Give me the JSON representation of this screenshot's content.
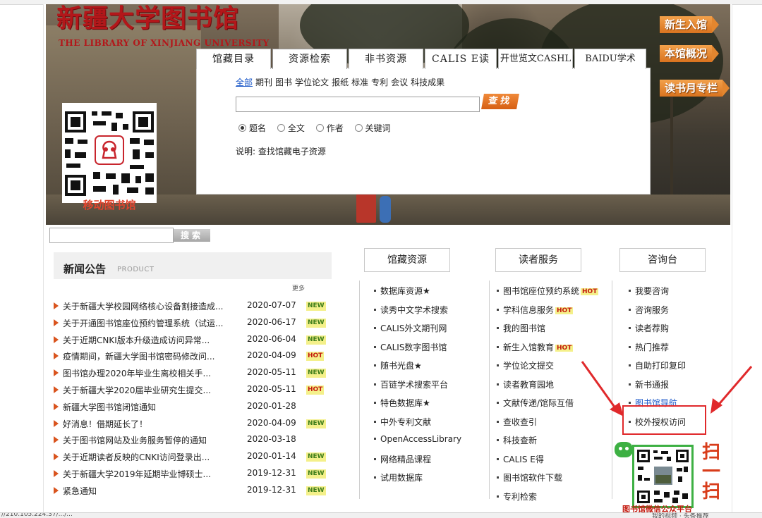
{
  "header": {
    "title": "新疆大学图书馆",
    "subtitle": "THE LIBRARY OF XINJIANG UNIVERSITY",
    "side_buttons": [
      "新生入馆",
      "本馆概况",
      "读书月专栏"
    ],
    "qr_caption": "移动图书馆"
  },
  "search": {
    "tabs": [
      "馆藏目录",
      "资源检索",
      "非书资源",
      "CALIS E读",
      "开世览文CASHL",
      "BAIDU学术"
    ],
    "active_tab": "资源检索",
    "categories": [
      "全部",
      "期刊",
      "图书",
      "学位论文",
      "报纸",
      "标准",
      "专利",
      "会议",
      "科技成果"
    ],
    "selected_category": "全部",
    "find_button": "查找",
    "radios": [
      "题名",
      "全文",
      "作者",
      "关键词"
    ],
    "selected_radio": "题名",
    "note": "说明: 查找馆藏电子资源",
    "site_search_button": "搜索"
  },
  "news": {
    "title": "新闻公告",
    "subtitle": "PRODUCT",
    "more": "更多",
    "items": [
      {
        "title": "关于新疆大学校园网络核心设备割接造成...",
        "date": "2020-07-07",
        "badge": "NEW"
      },
      {
        "title": "关于开通图书馆座位预约管理系统（试运...",
        "date": "2020-06-17",
        "badge": "NEW"
      },
      {
        "title": "关于近期CNKI版本升级造成访问异常...",
        "date": "2020-06-04",
        "badge": "NEW"
      },
      {
        "title": " 疫情期间，新疆大学图书馆密码修改问...",
        "date": "2020-04-09",
        "badge": "HOT"
      },
      {
        "title": "图书馆办理2020年毕业生离校相关手...",
        "date": "2020-05-11",
        "badge": "NEW"
      },
      {
        "title": "关于新疆大学2020届毕业研究生提交...",
        "date": "2020-05-11",
        "badge": "HOT"
      },
      {
        "title": "新疆大学图书馆闭馆通知",
        "date": "2020-01-28",
        "badge": ""
      },
      {
        "title": "好消息！借期延长了！",
        "date": "2020-04-09",
        "badge": "NEW"
      },
      {
        "title": "关于图书馆网站及业务服务暂停的通知",
        "date": "2020-03-18",
        "badge": ""
      },
      {
        "title": "关于近期读者反映的CNKI访问登录出...",
        "date": "2020-01-14",
        "badge": "NEW"
      },
      {
        "title": "关于新疆大学2019年延期毕业博硕士...",
        "date": "2019-12-31",
        "badge": "NEW"
      },
      {
        "title": "紧急通知",
        "date": "2019-12-31",
        "badge": "NEW"
      }
    ]
  },
  "resources": {
    "title": "馆藏资源",
    "items": [
      "数据库资源★",
      "读秀中文学术搜索",
      "CALIS外文期刊网",
      "CALIS数字图书馆",
      "随书光盘★",
      "百链学术搜索平台",
      "特色数据库★",
      "中外专利文献",
      "OpenAccessLibrary",
      "网络精品课程",
      "试用数据库"
    ]
  },
  "services": {
    "title": "读者服务",
    "items": [
      {
        "label": "图书馆座位预约系统",
        "badge": "HOT"
      },
      {
        "label": "学科信息服务",
        "badge": "HOT"
      },
      {
        "label": "我的图书馆",
        "badge": ""
      },
      {
        "label": "新生入馆教育",
        "badge": "HOT"
      },
      {
        "label": "学位论文提交",
        "badge": ""
      },
      {
        "label": "读者教育园地",
        "badge": ""
      },
      {
        "label": "文献传递/馆际互借",
        "badge": ""
      },
      {
        "label": "查收查引",
        "badge": ""
      },
      {
        "label": "科技查新",
        "badge": ""
      },
      {
        "label": "CALIS E得",
        "badge": ""
      },
      {
        "label": "图书馆软件下载",
        "badge": ""
      },
      {
        "label": "专利检索",
        "badge": ""
      }
    ]
  },
  "consult": {
    "title": "咨询台",
    "items": [
      "我要咨询",
      "咨询服务",
      "读者荐购",
      "热门推荐",
      "自助打印复印",
      "新书通报",
      "图书馆导航",
      "校外授权访问"
    ],
    "highlighted_item": "校外授权访问",
    "scan_text": "扫一扫",
    "bottom_caption": "图书馆微信公众平台"
  },
  "status_bar": {
    "url": "//210.105.224.37/.../...",
    "right": "我的视频 · 头条推荐"
  },
  "colors": {
    "accent": "#d9541e",
    "link": "#1a57c8",
    "highlight": "#e0292b",
    "title_red": "#b3171a",
    "wechat_green": "#3db043"
  }
}
